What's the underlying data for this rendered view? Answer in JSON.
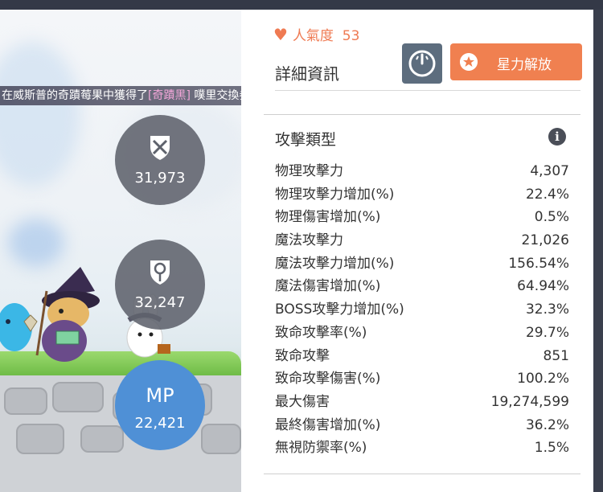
{
  "game": {
    "notice_prefix": "在威斯普的奇蹟莓果中獲得了",
    "notice_item": "[奇蹟黑]",
    "notice_suffix": " 噗里交換券。",
    "stat_attack": "31,973",
    "stat_magic": "32,247",
    "mp_label": "MP",
    "mp_value": "22,421"
  },
  "panel": {
    "popularity_label": "人氣度",
    "popularity_value": "53",
    "detail_title": "詳細資訊",
    "star_button": "星力解放",
    "section_title": "攻擊類型",
    "rows": [
      {
        "label": "物理攻擊力",
        "value": "4,307"
      },
      {
        "label": "物理攻擊力增加(%)",
        "value": "22.4%"
      },
      {
        "label": "物理傷害增加(%)",
        "value": "0.5%"
      },
      {
        "label": "魔法攻擊力",
        "value": "21,026"
      },
      {
        "label": "魔法攻擊力增加(%)",
        "value": "156.54%"
      },
      {
        "label": "魔法傷害增加(%)",
        "value": "64.94%"
      },
      {
        "label": "BOSS攻擊力增加(%)",
        "value": "32.3%"
      },
      {
        "label": "致命攻擊率(%)",
        "value": "29.7%"
      },
      {
        "label": "致命攻擊",
        "value": "851"
      },
      {
        "label": "致命攻擊傷害(%)",
        "value": "100.2%"
      },
      {
        "label": "最大傷害",
        "value": "19,274,599"
      },
      {
        "label": "最終傷害增加(%)",
        "value": "36.2%"
      },
      {
        "label": "無視防禦率(%)",
        "value": "1.5%"
      }
    ]
  },
  "colors": {
    "accent": "#f08050",
    "popularity": "#ef7a52",
    "mp": "#4f90d6",
    "gauge_button": "#5d6d7e"
  },
  "icons": [
    "heart-icon",
    "gauge-icon",
    "star-icon",
    "info-icon",
    "sword-shield-icon",
    "magic-icon"
  ]
}
